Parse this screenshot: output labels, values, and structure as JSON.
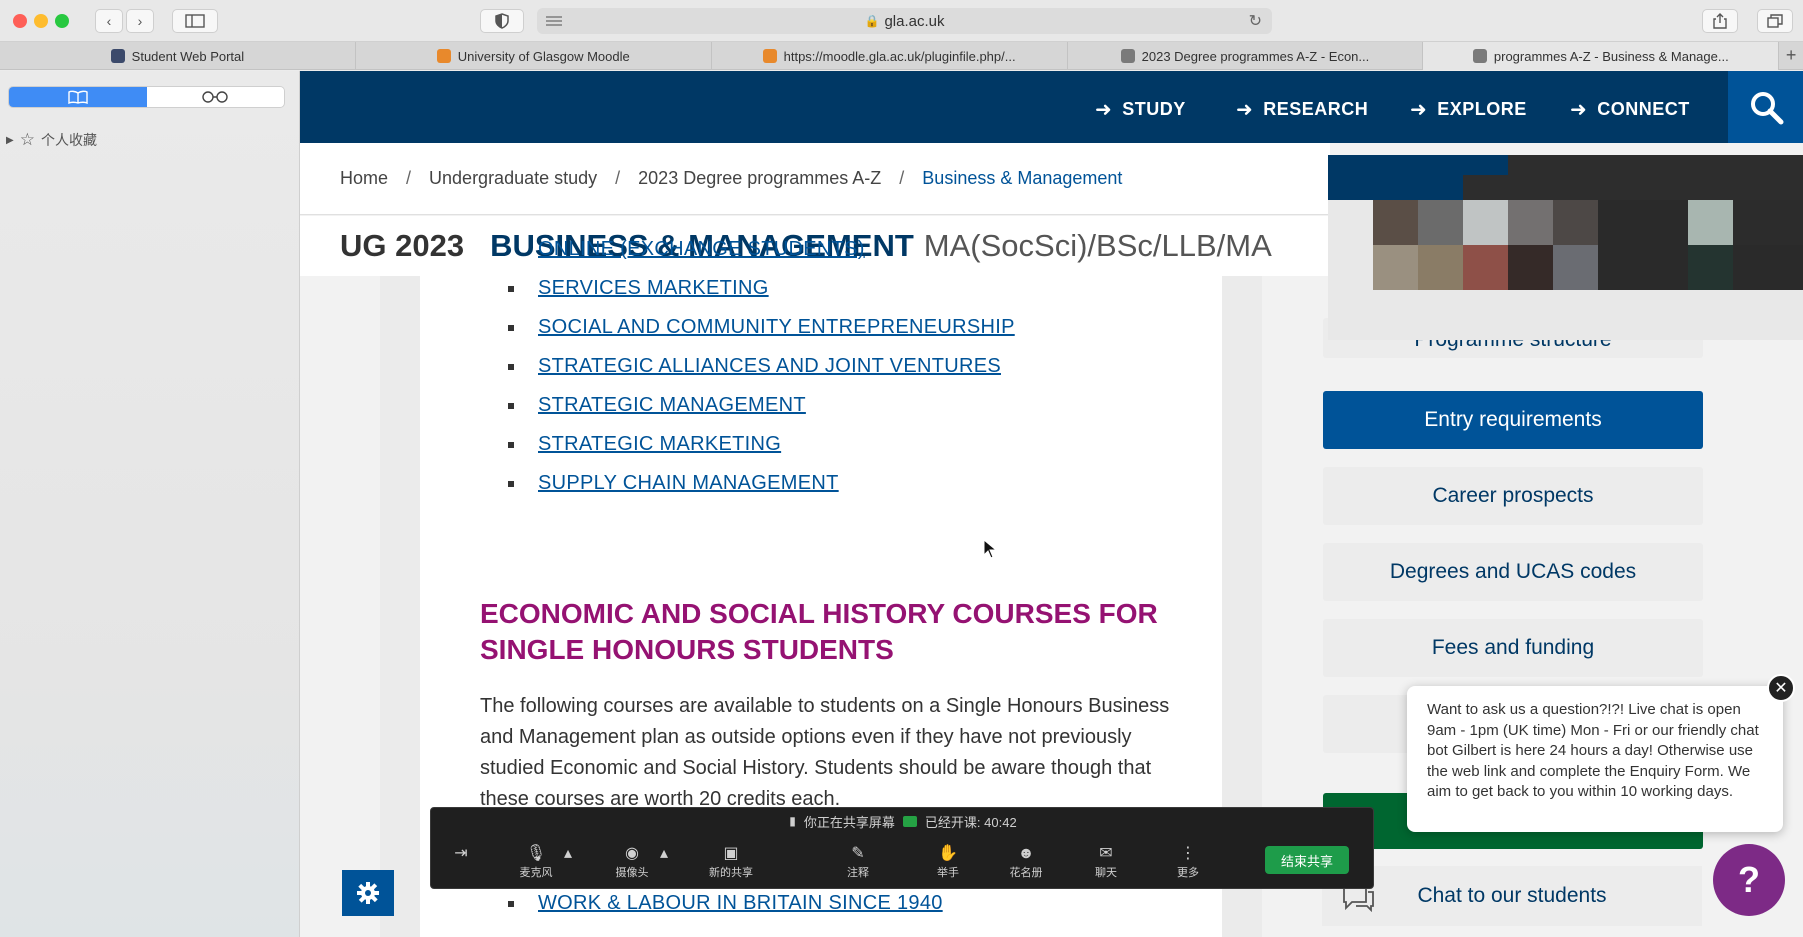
{
  "browser": {
    "url": "gla.ac.uk",
    "tabs": [
      {
        "label": "Student Web Portal",
        "color": "#3c4a6b"
      },
      {
        "label": "University of Glasgow Moodle",
        "color": "#e8892c"
      },
      {
        "label": "https://moodle.gla.ac.uk/pluginfile.php/...",
        "color": "#e8892c"
      },
      {
        "label": "2023 Degree programmes A-Z - Econ...",
        "color": "#7a7a7a"
      },
      {
        "label": "programmes A-Z - Business & Manage...",
        "color": "#7a7a7a"
      }
    ]
  },
  "sidebar": {
    "bookmarks_label": "个人收藏"
  },
  "nav": {
    "items": [
      "STUDY",
      "RESEARCH",
      "EXPLORE",
      "CONNECT"
    ]
  },
  "breadcrumb": {
    "items": [
      "Home",
      "Undergraduate study",
      "2023 Degree programmes A-Z"
    ],
    "current": "Business & Management"
  },
  "title": {
    "prefix": "UG 2023",
    "main": "BUSINESS & MANAGEMENT",
    "degrees": "MA(SocSci)/BSc/LLB/MA"
  },
  "courses": [
    "ONLINE (EXCHANGE STUDENTS)",
    "SERVICES MARKETING",
    "SOCIAL AND COMMUNITY ENTREPRENEURSHIP",
    "STRATEGIC ALLIANCES AND JOINT VENTURES",
    "STRATEGIC MANAGEMENT",
    "STRATEGIC MARKETING",
    "SUPPLY CHAIN MANAGEMENT"
  ],
  "section": {
    "heading": "ECONOMIC AND SOCIAL HISTORY COURSES FOR SINGLE HONOURS STUDENTS",
    "paragraph": "The following courses are available to students on a Single Honours Business and Management plan as outside options even if they have not previously studied Economic and Social History. Students should be aware though that these courses are worth 20 credits each."
  },
  "last_course": "WORK & LABOUR IN BRITAIN SINCE 1940",
  "side_menu": {
    "programme_structure": "Programme structure",
    "entry_requirements": "Entry requirements",
    "career_prospects": "Career prospects",
    "degrees_ucas": "Degrees and UCAS codes",
    "fees_funding": "Fees and funding",
    "chat_students": "Chat to our students"
  },
  "chat_popup": {
    "text": "Want to ask us a question?!?! Live chat is open 9am - 1pm (UK time) Mon - Fri or our friendly chat bot Gilbert is here 24 hours a day! Otherwise use the web link and complete the Enquiry Form. We aim to get back to you within 10 working days.",
    "help_label": "?"
  },
  "share_bar": {
    "sharing": "你正在共享屏幕",
    "elapsed": "已经开课: 40:42",
    "items": [
      "麦克风",
      "摄像头",
      "新的共享",
      "注释",
      "举手",
      "花名册",
      "聊天",
      "更多"
    ],
    "end_label": "结束共享"
  },
  "colors": {
    "uofg_navy": "#003865",
    "uofg_blue": "#005398",
    "heading_purple": "#951272"
  }
}
